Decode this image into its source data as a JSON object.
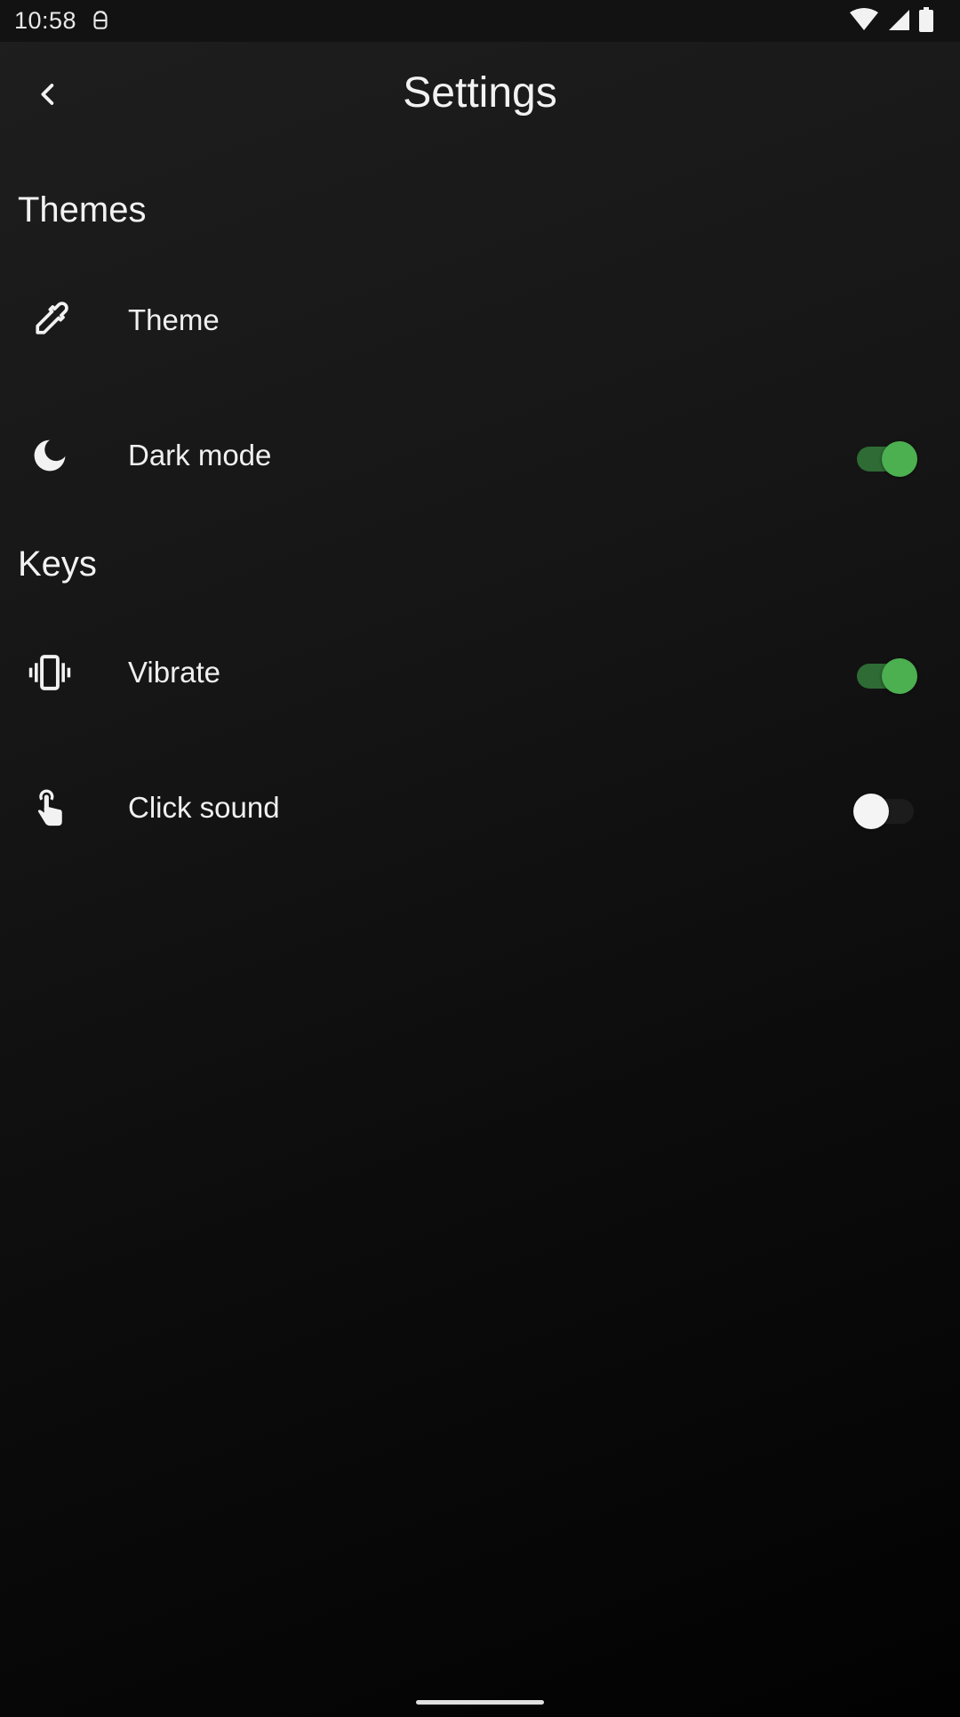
{
  "status_bar": {
    "time": "10:58",
    "notification_icon": "android-debug-icon",
    "icons": [
      "wifi-icon",
      "cellular-signal-icon",
      "battery-icon"
    ]
  },
  "app_bar": {
    "title": "Settings",
    "back_icon": "chevron-left-icon"
  },
  "sections": [
    {
      "header": "Themes",
      "items": [
        {
          "label": "Theme",
          "icon": "eyedropper-icon"
        },
        {
          "label": "Dark mode",
          "icon": "moon-icon",
          "toggle": true
        }
      ]
    },
    {
      "header": "Keys",
      "items": [
        {
          "label": "Vibrate",
          "icon": "vibrate-icon",
          "toggle": true
        },
        {
          "label": "Click sound",
          "icon": "touch-icon",
          "toggle": false
        }
      ]
    }
  ],
  "colors": {
    "accent": "#4caf50",
    "accent_track": "#2e6b35",
    "background_top": "#1e1e1e",
    "background_bottom": "#020202",
    "text": "#f0f0f0"
  }
}
